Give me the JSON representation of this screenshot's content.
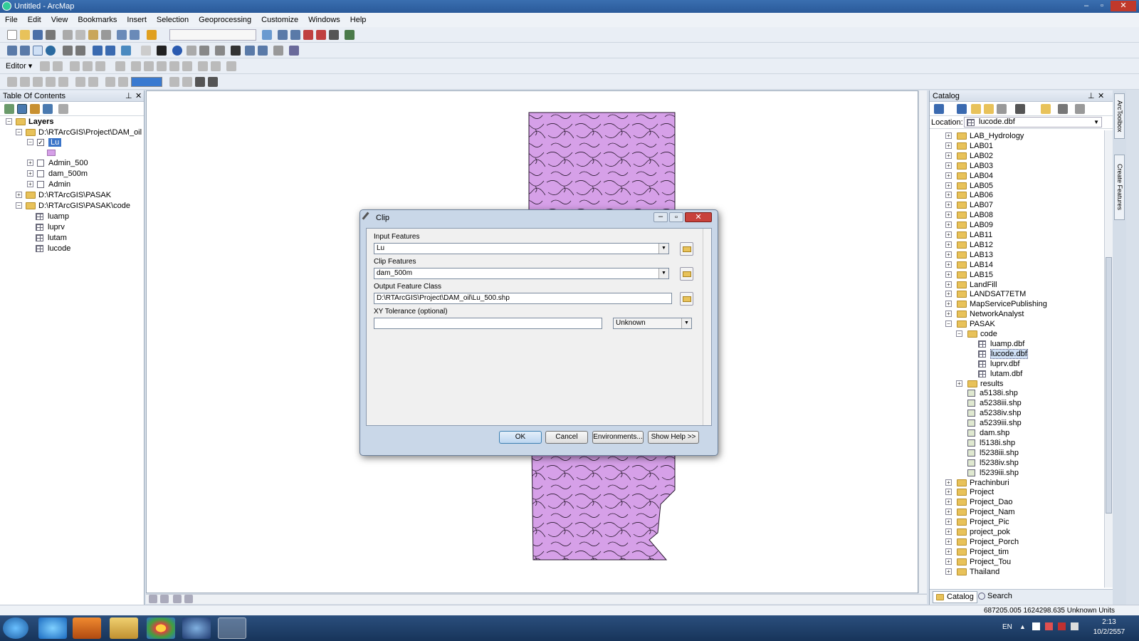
{
  "window": {
    "title": "Untitled - ArcMap"
  },
  "menu": [
    "File",
    "Edit",
    "View",
    "Bookmarks",
    "Insert",
    "Selection",
    "Geoprocessing",
    "Customize",
    "Windows",
    "Help"
  ],
  "editor": {
    "label": "Editor ▾"
  },
  "toc": {
    "title": "Table Of Contents",
    "root": "Layers",
    "group1": "D:\\RTArcGIS\\Project\\DAM_oil",
    "layer_selected": "Lu",
    "layers": [
      "Admin_500",
      "dam_500m",
      "Admin"
    ],
    "group2": "D:\\RTArcGIS\\PASAK",
    "group3": "D:\\RTArcGIS\\PASAK\\code",
    "tables": [
      "luamp",
      "luprv",
      "lutam",
      "lucode"
    ]
  },
  "catalog": {
    "title": "Catalog",
    "location_label": "Location:",
    "location_value": "lucode.dbf",
    "items_top": [
      "LAB_Hydrology",
      "LAB01",
      "LAB02",
      "LAB03",
      "LAB04",
      "LAB05",
      "LAB06",
      "LAB07",
      "LAB08",
      "LAB09",
      "LAB11",
      "LAB12",
      "LAB13",
      "LAB14",
      "LAB15",
      "LandFill",
      "LANDSAT7ETM",
      "MapServicePublishing",
      "NetworkAnalyst",
      "PASAK"
    ],
    "code_folder": "code",
    "code_files": [
      "luamp.dbf",
      "lucode.dbf",
      "luprv.dbf",
      "lutam.dbf"
    ],
    "results": "results",
    "shp_files": [
      "a5138i.shp",
      "a5238iii.shp",
      "a5238iv.shp",
      "a5239iii.shp",
      "dam.shp",
      "l5138i.shp",
      "l5238iii.shp",
      "l5238iv.shp",
      "l5239iii.shp"
    ],
    "items_bottom": [
      "Prachinburi",
      "Project",
      "Project_Dao",
      "Project_Nam",
      "Project_Pic",
      "project_pok",
      "Project_Porch",
      "Project_tim",
      "Project_Tou",
      "Thailand"
    ],
    "tab_catalog": "Catalog",
    "tab_search": "Search"
  },
  "right_tabs": [
    "ArcToolbox",
    "Create Features"
  ],
  "dialog": {
    "title": "Clip",
    "input_label": "Input Features",
    "input_value": "Lu",
    "clip_label": "Clip Features",
    "clip_value": "dam_500m",
    "output_label": "Output Feature Class",
    "output_value": "D:\\RTArcGIS\\Project\\DAM_oil\\Lu_500.shp",
    "xy_label": "XY Tolerance (optional)",
    "xy_value": "",
    "unit_value": "Unknown",
    "ok": "OK",
    "cancel": "Cancel",
    "environments": "Environments...",
    "show_help": "Show Help >>"
  },
  "status": {
    "coords": "687205.005  1624298.635 Unknown Units"
  },
  "taskbar": {
    "lang": "EN",
    "time": "2:13",
    "date": "10/2/2557"
  },
  "colors": {
    "polygon_fill": "#d6a0e8",
    "polygon_stroke": "#2a1a30",
    "folder": "#e8c25a"
  }
}
